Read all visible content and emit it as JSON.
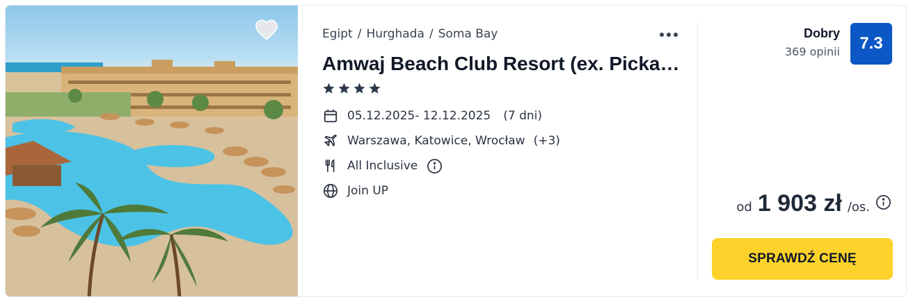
{
  "offer": {
    "breadcrumb": [
      "Egipt",
      "Hurghada",
      "Soma Bay"
    ],
    "breadcrumb_separator": "/",
    "hotel_name": "Amwaj Beach Club Resort (ex. Picka…",
    "stars": 4,
    "dates": "05.12.2025- 12.12.2025",
    "duration": "(7 dni)",
    "departures": "Warszawa, Katowice, Wrocław",
    "departures_extra": "(+3)",
    "board": "All Inclusive",
    "tour_operator": "Join UP",
    "rating": {
      "label": "Dobry",
      "reviews": "369 opinii",
      "score": "7.3"
    },
    "price": {
      "prefix": "od",
      "value": "1 903 zł",
      "unit": "/os."
    },
    "cta_label": "SPRAWDŹ CENĘ"
  },
  "icons": {
    "favorite": "heart-icon",
    "more": "more-dots-icon",
    "star": "star-icon",
    "dates": "calendar-icon",
    "departures": "plane-icon",
    "board": "cutlery-icon",
    "board_info": "info-icon",
    "tour_operator": "globe-icon",
    "price_info": "info-icon"
  },
  "colors": {
    "rating_badge": "#0b57c5",
    "cta": "#fdd22a",
    "star": "#2f3a4a",
    "text": "#1f2937"
  }
}
